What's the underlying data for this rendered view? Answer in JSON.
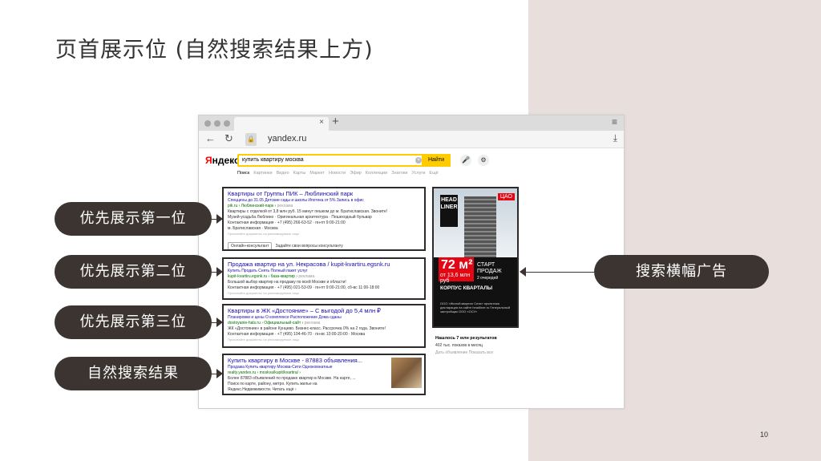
{
  "slide": {
    "title": "页首展示位 (自然搜索结果上方)",
    "page_number": "10"
  },
  "labels": {
    "first": "优先展示第一位",
    "second": "优先展示第二位",
    "third": "优先展示第三位",
    "organic": "自然搜索结果",
    "banner": "搜索横幅广告"
  },
  "browser": {
    "url": "yandex.ru",
    "tab_close": "×",
    "new_tab": "+"
  },
  "yandex": {
    "logo_first": "Я",
    "logo_rest": "ндекс",
    "query": "купить квартиру москва",
    "search_button": "Найти",
    "tabs": [
      "Поиск",
      "Картинки",
      "Видео",
      "Карты",
      "Маркет",
      "Новости",
      "Эфир",
      "Коллекции",
      "Знатоки",
      "Услуги",
      "Ещё"
    ]
  },
  "results": {
    "ad1": {
      "title": "Квартиры от Группы ПИК – Люблинский парк",
      "links": "Спеццены до 31.05   Детские сады и школы   Ипотека от 5%   Запись в офис",
      "url": "pik.ru › Люблинский-парк ›",
      "tag": "реклама",
      "line1": "Квартиры с отделкой от 3,8 млн руб. 15 минут пешком до м. Братиславская. Звоните!",
      "line2": "Музей-усадьба Люблино · Оригинальная архитектура · Пешеходный бульвар",
      "line3": "Контактная информация · +7 (495) 266-63-52 · пн-пт 9:00-21:00",
      "line4": "м. Братиславская · Москва",
      "fine": "Прочитайте документы на рекламируемое лицо",
      "consult": "Онлайн-консультант",
      "consult_note": "Задайте свои вопросы консультанту"
    },
    "ad2": {
      "title": "Продажа квартир на ул. Некрасова / kupit-kvartiru.egsnk.ru",
      "links": "Купить   Продать   Снять   Полный пакет услуг",
      "url": "kupit-kvartiru.egsnk.ru › база-квартир ›",
      "tag": "реклама",
      "line1": "Большой выбор квартир на продажу по всей Москве и области!",
      "line2": "Контактная информация · +7 (495) 021-53-09 · пн-пт 9:00-21:00, сб-вс 11:00-18:00",
      "fine": "Прочитайте документы на рекламируемое лицо"
    },
    "ad3": {
      "title": "Квартиры в ЖК «Достояние» – С выгодой до 5,4 млн ₽",
      "links": "Планировки и цены   О комплексе   Расположение   Дома сданы",
      "url": "dostoyanie-hals.ru › Официальный-сайт ›",
      "tag": "реклама",
      "line1": "ЖК «Достояние» в районе Кунцево. Бизнес-класс. Рассрочка 0% на 2 года. Звоните!",
      "line2": "Контактная информация · +7 (495) 104-46-70 · пн-вс 10:00-20:00 · Москва",
      "fine": "Прочитайте документы на рекламируемое лицо"
    },
    "organic": {
      "title": "Купить квартиру в Москве - 87883 объявления...",
      "links": "Продажа   Купить квартиру Москва-Сити   Однокомнатные",
      "url": "realty.yandex.ru › moskva/kupit/kvartira/ ›",
      "line1": "Более 87883 объявлений по продаже квартир в Москве. На карте, ...",
      "line2": "Поиск по карте, району, метро. Купить жилье на",
      "line3": "Яндекс.Недвижимости. Читать ещё ›"
    }
  },
  "banner": {
    "logo": "HEAD LINER",
    "cao": "ЦАО",
    "price_big": "72 м²",
    "price_small": "от 13,6 млн руб",
    "start1": "СТАРТ",
    "start2": "ПРОДАЖ",
    "start3": "2 очередей",
    "title": "КОРПУС КВАРТАЛЫ",
    "fine": "ООО «Жилой квартал Сити» проектная декларация на сайте headliner.ru Генеральный застройщик ООО «ОСУ»"
  },
  "stats": {
    "found": "Нашлось 7 млн результатов",
    "shows": "402 тыс. показов в месяц",
    "links": "Дать объявление   Показать все"
  },
  "icons": {
    "mic": "🎤",
    "filters": "⚙"
  },
  "colors": {
    "pill_bg": "#3b3430",
    "right_panel_bg": "#e8dfdd",
    "yandex_yellow": "#ffcc00",
    "link_blue": "#1a0dab",
    "url_green": "#007000"
  }
}
